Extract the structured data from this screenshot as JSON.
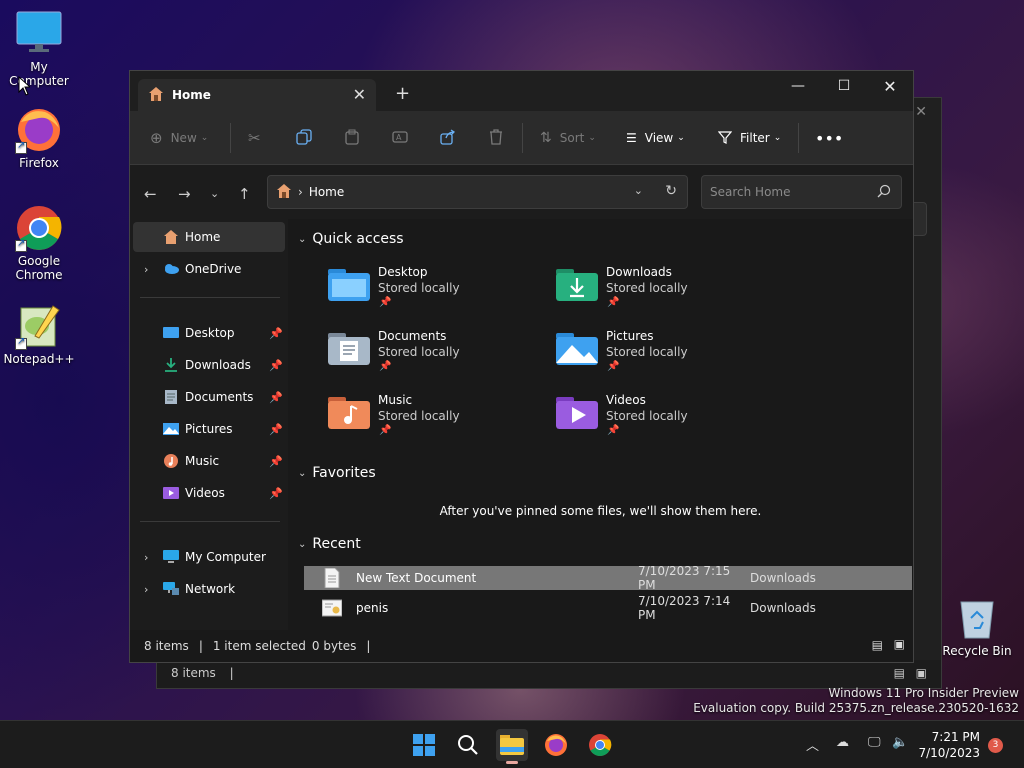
{
  "desktop": {
    "icons": [
      {
        "label": "My Computer"
      },
      {
        "label": "Firefox"
      },
      {
        "label": "Google Chrome"
      },
      {
        "label": "Notepad++"
      }
    ],
    "recycle_bin": "Recycle Bin",
    "watermark_line1": "Windows 11 Pro Insider Preview",
    "watermark_line2": "Evaluation copy. Build 25375.zn_release.230520-1632"
  },
  "bg_window": {
    "status": "8 items"
  },
  "window": {
    "tab_title": "Home",
    "toolbar": {
      "new": "New",
      "sort": "Sort",
      "view": "View",
      "filter": "Filter"
    },
    "address": {
      "location": "Home",
      "search_placeholder": "Search Home"
    },
    "sidebar": {
      "home": "Home",
      "onedrive": "OneDrive",
      "pinned": [
        {
          "label": "Desktop"
        },
        {
          "label": "Downloads"
        },
        {
          "label": "Documents"
        },
        {
          "label": "Pictures"
        },
        {
          "label": "Music"
        },
        {
          "label": "Videos"
        }
      ],
      "my_computer": "My Computer",
      "network": "Network"
    },
    "quick_access": {
      "heading": "Quick access",
      "items": [
        {
          "name": "Desktop",
          "sub": "Stored locally"
        },
        {
          "name": "Downloads",
          "sub": "Stored locally"
        },
        {
          "name": "Documents",
          "sub": "Stored locally"
        },
        {
          "name": "Pictures",
          "sub": "Stored locally"
        },
        {
          "name": "Music",
          "sub": "Stored locally"
        },
        {
          "name": "Videos",
          "sub": "Stored locally"
        }
      ]
    },
    "favorites": {
      "heading": "Favorites",
      "empty_text": "After you've pinned some files, we'll show them here."
    },
    "recent": {
      "heading": "Recent",
      "rows": [
        {
          "name": "New Text Document",
          "date": "7/10/2023 7:15 PM",
          "location": "Downloads"
        },
        {
          "name": "penis",
          "date": "7/10/2023 7:14 PM",
          "location": "Downloads"
        }
      ]
    },
    "status": {
      "items": "8 items",
      "selected": "1 item selected",
      "size": "0 bytes"
    }
  },
  "taskbar": {
    "time": "7:21 PM",
    "date": "7/10/2023",
    "notifications": "3"
  },
  "colors": {
    "accent": "#0078d4",
    "folder_blue": "#3ea1f0",
    "folder_green": "#27b07f",
    "selection": "#777777"
  }
}
